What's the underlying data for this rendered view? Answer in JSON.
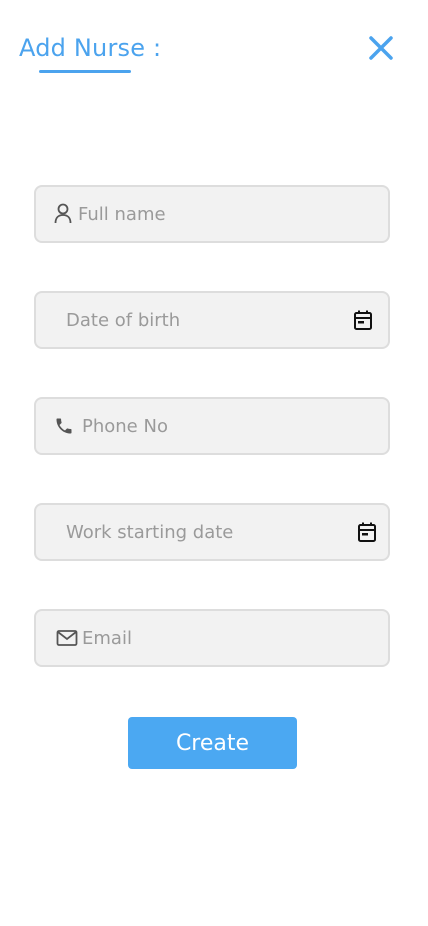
{
  "header": {
    "title": "Add Nurse :",
    "close_icon": "close-icon"
  },
  "form": {
    "full_name": {
      "placeholder": "Full name",
      "value": "",
      "icon": "user-icon"
    },
    "date_of_birth": {
      "placeholder": "Date of birth",
      "value": "",
      "icon": "calendar-icon"
    },
    "phone": {
      "placeholder": "Phone No",
      "value": "",
      "icon": "phone-icon"
    },
    "work_start_date": {
      "placeholder": "Work starting date",
      "value": "",
      "icon": "calendar-icon"
    },
    "email": {
      "placeholder": "Email",
      "value": "",
      "icon": "mail-icon"
    },
    "submit_label": "Create"
  },
  "colors": {
    "accent": "#4BA3EE",
    "button": "#4BA8F2",
    "field_bg": "#F2F2F2",
    "field_border": "#DDDDDD"
  }
}
